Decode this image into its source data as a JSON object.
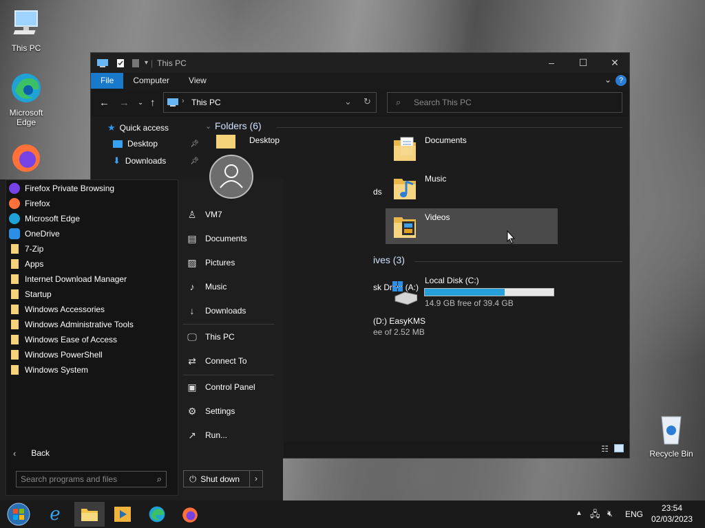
{
  "desktop": {
    "this_pc_label": "This PC",
    "edge_label_1": "Microsoft",
    "edge_label_2": "Edge",
    "recycle_label": "Recycle Bin"
  },
  "explorer": {
    "title": "This PC",
    "tabs": [
      "File",
      "Computer",
      "View"
    ],
    "address": "This PC",
    "search_placeholder": "Search This PC",
    "nav": {
      "quick_access": "Quick access",
      "desktop": "Desktop",
      "downloads": "Downloads"
    },
    "folders_header": "Folders (6)",
    "folders": [
      "Desktop",
      "Documents",
      "Music",
      "Videos"
    ],
    "partial_downloads": "ds",
    "drives_header_partial": "ives (3)",
    "drive_a_partial": "sk Drive (A:)",
    "drive_d_partial_1": "(D:) EasyKMS",
    "drive_d_partial_2": "ee of 2.52 MB",
    "drive_c": {
      "name": "Local Disk (C:)",
      "free": "14.9 GB free of 39.4 GB",
      "used_fraction": 0.62
    }
  },
  "startmenu": {
    "programs": [
      "Firefox Private Browsing",
      "Firefox",
      "Microsoft Edge",
      "OneDrive",
      "7-Zip",
      "Apps",
      "Internet Download Manager",
      "Startup",
      "Windows Accessories",
      "Windows Administrative Tools",
      "Windows Ease of Access",
      "Windows PowerShell",
      "Windows System"
    ],
    "back": "Back",
    "search_placeholder": "Search programs and files",
    "user": "VM7",
    "links": [
      "Documents",
      "Pictures",
      "Music",
      "Downloads"
    ],
    "this_pc": "This PC",
    "connect_to": "Connect To",
    "control_panel": "Control Panel",
    "settings": "Settings",
    "run": "Run...",
    "shutdown": "Shut down"
  },
  "taskbar": {
    "lang": "ENG",
    "time": "23:54",
    "date": "02/03/2023"
  },
  "colors": {
    "accent": "#1979ca",
    "drive_bar": "#26a0da"
  }
}
